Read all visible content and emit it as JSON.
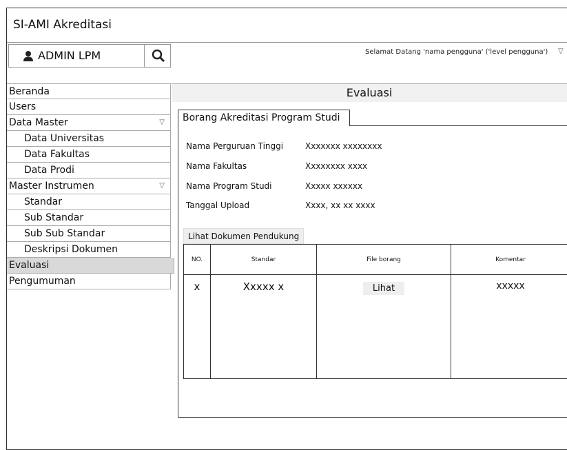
{
  "app": {
    "title": "SI-AMI Akreditasi"
  },
  "user": {
    "name": "ADMIN LPM"
  },
  "header": {
    "greeting": "Selamat Datang 'nama pengguna' ('level pengguna')"
  },
  "sidebar": {
    "items": [
      {
        "label": "Beranda"
      },
      {
        "label": "Users"
      },
      {
        "label": "Data Master"
      },
      {
        "label": "Data Universitas"
      },
      {
        "label": "Data Fakultas"
      },
      {
        "label": "Data Prodi"
      },
      {
        "label": "Master Instrumen"
      },
      {
        "label": "Standar"
      },
      {
        "label": "Sub Standar"
      },
      {
        "label": "Sub Sub Standar"
      },
      {
        "label": "Deskripsi Dokumen"
      },
      {
        "label": "Evaluasi"
      },
      {
        "label": "Pengumuman"
      }
    ]
  },
  "main": {
    "title": "Evaluasi",
    "tab": "Borang Akreditasi Program Studi",
    "info": [
      {
        "label": "Nama Perguruan Tinggi",
        "value": "Xxxxxxx xxxxxxxx"
      },
      {
        "label": "Nama Fakultas",
        "value": "Xxxxxxxx xxxx"
      },
      {
        "label": "Nama Program Studi",
        "value": "Xxxxx xxxxxx"
      },
      {
        "label": "Tanggal Upload",
        "value": "Xxxx, xx xx xxxx"
      }
    ],
    "doc_button": "Lihat Dokumen Pendukung",
    "table": {
      "headers": [
        "NO.",
        "Standar",
        "File borang",
        "Komentar"
      ],
      "rows": [
        {
          "no": "x",
          "standar": "Xxxxx x",
          "file_button": "Lihat",
          "komentar": "xxxxx"
        }
      ]
    }
  }
}
